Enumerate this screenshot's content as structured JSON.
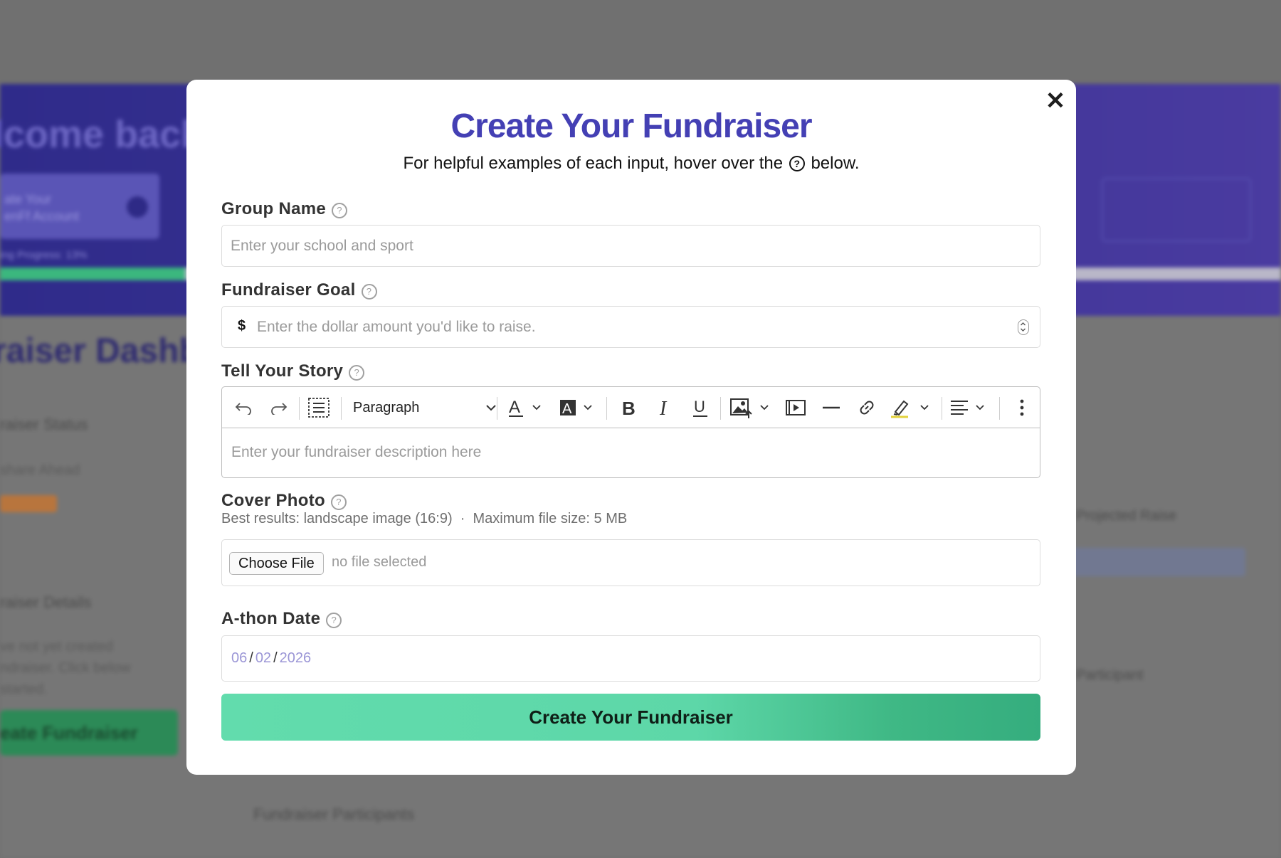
{
  "background": {
    "welcome": "lcome back,",
    "card_text": "ate Your\nenFf Account",
    "progress_label": "ing Progress: 13%",
    "dashboard_title": "raiser Dashb",
    "status_label": "raiser Status",
    "share_label": "share Ahead",
    "details_label": "raiser Details",
    "details_text": "ve not yet created\nndraiser. Click below\nstarted.",
    "create_btn": "eate Fundraiser",
    "projected": "Projected Raise",
    "participant": "r Participant",
    "participants_section": "Fundraiser Participants"
  },
  "modal": {
    "title": "Create Your Fundraiser",
    "subtitle_before": "For helpful examples of each input, hover over the",
    "subtitle_after": "below.",
    "help_glyph": "?",
    "close_glyph": "✕"
  },
  "fields": {
    "group_name": {
      "label": "Group Name",
      "placeholder": "Enter your school and sport"
    },
    "goal": {
      "label": "Fundraiser Goal",
      "currency": "$",
      "placeholder": "Enter the dollar amount you'd like to raise."
    },
    "story": {
      "label": "Tell Your Story",
      "placeholder": "Enter your fundraiser description here",
      "block_format": "Paragraph"
    },
    "cover": {
      "label": "Cover Photo",
      "helper": "Best results: landscape image (16:9)  ·  Maximum file size: 5 MB",
      "button": "Choose File",
      "status": "no file selected"
    },
    "date": {
      "label": "A-thon Date",
      "month": "06",
      "day": "02",
      "year": "2026"
    }
  },
  "toolbar_icons": [
    "undo-icon",
    "redo-icon",
    "select-all-icon",
    "font-color-icon",
    "background-color-icon",
    "bold-icon",
    "italic-icon",
    "underline-icon",
    "insert-image-icon",
    "insert-video-icon",
    "horizontal-rule-icon",
    "link-icon",
    "highlight-icon",
    "align-icon",
    "more-icon"
  ],
  "submit": {
    "label": "Create Your Fundraiser"
  },
  "colors": {
    "accent": "#4440b4",
    "submit_start": "#62dcad",
    "submit_end": "#35ad7e"
  }
}
